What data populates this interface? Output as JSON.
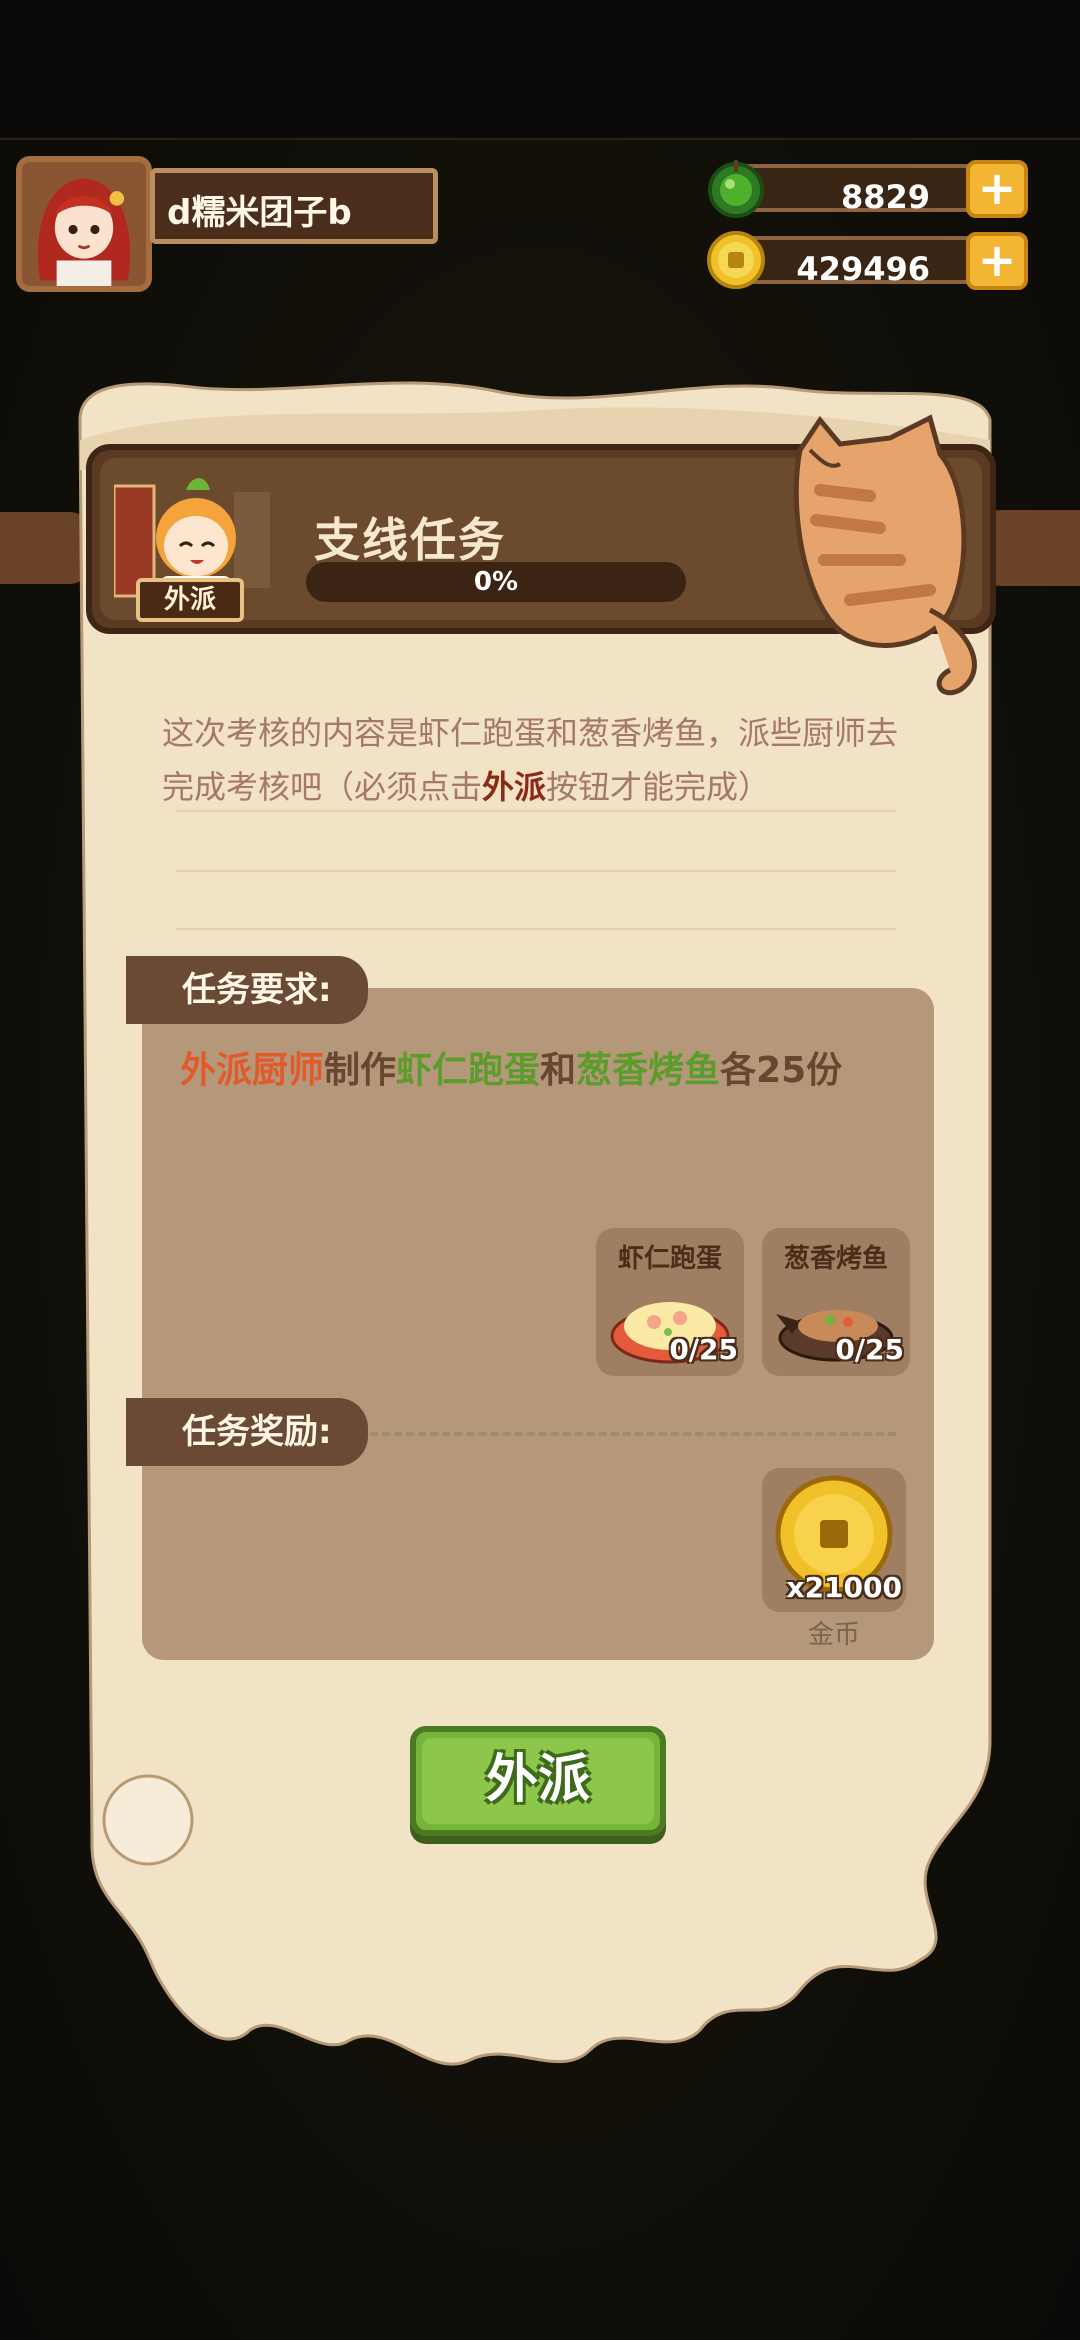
{
  "player": {
    "name": "d糯米团子b"
  },
  "resources": {
    "jade": "8829",
    "coins": "429496"
  },
  "quest": {
    "title": "支线任务",
    "badge": "外派",
    "progress_text": "0%",
    "progress_fraction": 0,
    "description_part1": "这次考核的内容是虾仁跑蛋和葱香烤鱼，派些厨师去完成考核吧（必须点击",
    "description_highlight": "外派",
    "description_part2": "按钮才能完成）",
    "requirement_label": "任务要求:",
    "requirement": {
      "part1": "外派厨师",
      "part2": "制作",
      "part3": "虾仁跑蛋",
      "part4": "和",
      "part5": "葱香烤鱼",
      "part6": "各25份"
    },
    "dishes": [
      {
        "name": "虾仁跑蛋",
        "count": "0/25"
      },
      {
        "name": "葱香烤鱼",
        "count": "0/25"
      }
    ],
    "reward_label": "任务奖励:",
    "reward": {
      "amount": "x21000",
      "name": "金币"
    },
    "action_button": "外派"
  },
  "colors": {
    "highlight_red": "#e05a2c",
    "highlight_green": "#5c9c2c",
    "button_green": "#8cc64a"
  }
}
